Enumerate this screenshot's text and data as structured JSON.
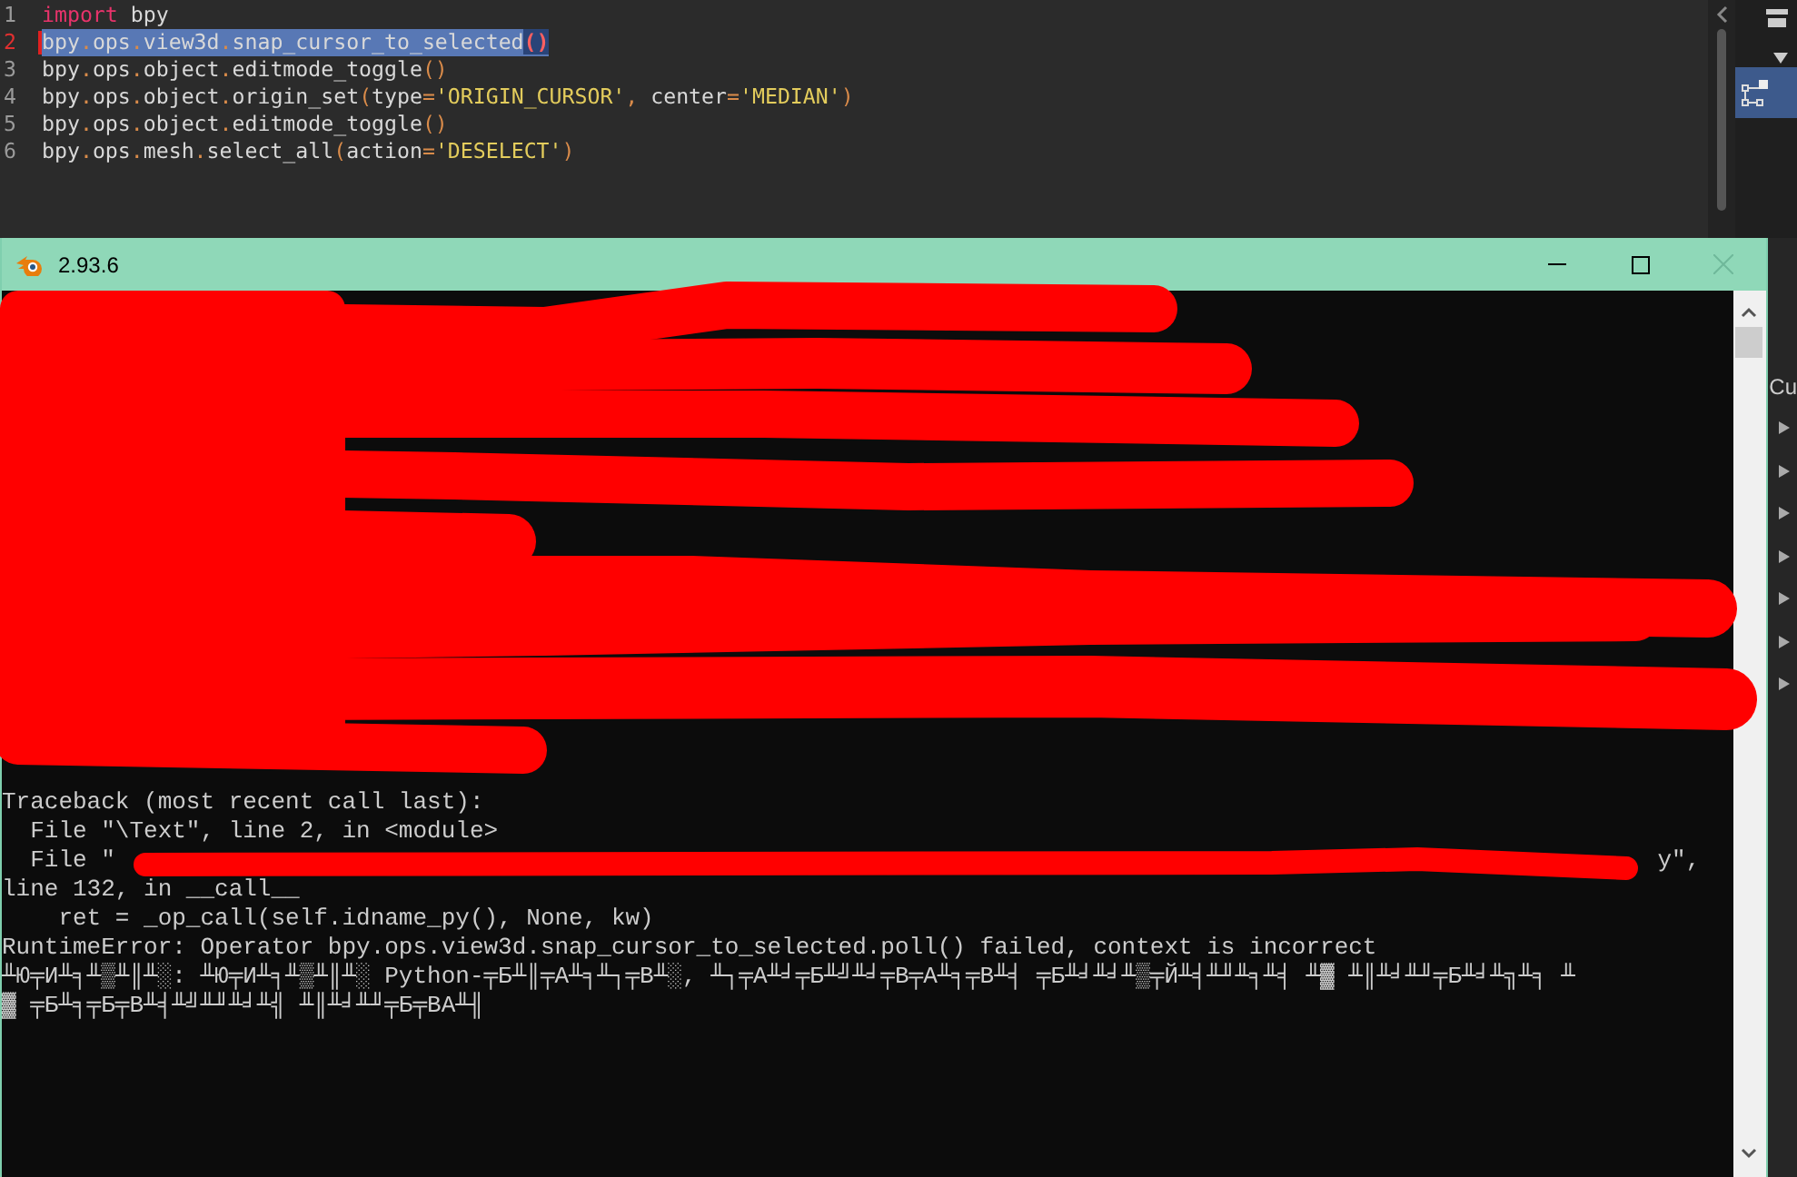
{
  "editor": {
    "lines": [
      {
        "number": "1",
        "current": false,
        "selected": false,
        "tokens": [
          {
            "kind": "keyword",
            "text": "import"
          },
          {
            "kind": "plain",
            "text": " bpy"
          }
        ]
      },
      {
        "number": "2",
        "current": true,
        "selected": true,
        "tokens": [
          {
            "kind": "plain",
            "text": "bpy"
          },
          {
            "kind": "punct",
            "text": "."
          },
          {
            "kind": "plain",
            "text": "ops"
          },
          {
            "kind": "punct",
            "text": "."
          },
          {
            "kind": "plain",
            "text": "view3d"
          },
          {
            "kind": "punct",
            "text": "."
          },
          {
            "kind": "plain",
            "text": "snap_cursor_to_selected"
          },
          {
            "kind": "match",
            "text": "()"
          }
        ]
      },
      {
        "number": "3",
        "current": false,
        "selected": false,
        "tokens": [
          {
            "kind": "plain",
            "text": "bpy"
          },
          {
            "kind": "punct",
            "text": "."
          },
          {
            "kind": "plain",
            "text": "ops"
          },
          {
            "kind": "punct",
            "text": "."
          },
          {
            "kind": "plain",
            "text": "object"
          },
          {
            "kind": "punct",
            "text": "."
          },
          {
            "kind": "plain",
            "text": "editmode_toggle"
          },
          {
            "kind": "punct",
            "text": "()"
          }
        ]
      },
      {
        "number": "4",
        "current": false,
        "selected": false,
        "tokens": [
          {
            "kind": "plain",
            "text": "bpy"
          },
          {
            "kind": "punct",
            "text": "."
          },
          {
            "kind": "plain",
            "text": "ops"
          },
          {
            "kind": "punct",
            "text": "."
          },
          {
            "kind": "plain",
            "text": "object"
          },
          {
            "kind": "punct",
            "text": "."
          },
          {
            "kind": "plain",
            "text": "origin_set"
          },
          {
            "kind": "punct",
            "text": "("
          },
          {
            "kind": "plain",
            "text": "type"
          },
          {
            "kind": "punct",
            "text": "="
          },
          {
            "kind": "string",
            "text": "'ORIGIN_CURSOR'"
          },
          {
            "kind": "punct",
            "text": ","
          },
          {
            "kind": "plain",
            "text": " center"
          },
          {
            "kind": "punct",
            "text": "="
          },
          {
            "kind": "string",
            "text": "'MEDIAN'"
          },
          {
            "kind": "punct",
            "text": ")"
          }
        ]
      },
      {
        "number": "5",
        "current": false,
        "selected": false,
        "tokens": [
          {
            "kind": "plain",
            "text": "bpy"
          },
          {
            "kind": "punct",
            "text": "."
          },
          {
            "kind": "plain",
            "text": "ops"
          },
          {
            "kind": "punct",
            "text": "."
          },
          {
            "kind": "plain",
            "text": "object"
          },
          {
            "kind": "punct",
            "text": "."
          },
          {
            "kind": "plain",
            "text": "editmode_toggle"
          },
          {
            "kind": "punct",
            "text": "()"
          }
        ]
      },
      {
        "number": "6",
        "current": false,
        "selected": false,
        "tokens": [
          {
            "kind": "plain",
            "text": "bpy"
          },
          {
            "kind": "punct",
            "text": "."
          },
          {
            "kind": "plain",
            "text": "ops"
          },
          {
            "kind": "punct",
            "text": "."
          },
          {
            "kind": "plain",
            "text": "mesh"
          },
          {
            "kind": "punct",
            "text": "."
          },
          {
            "kind": "plain",
            "text": "select_all"
          },
          {
            "kind": "punct",
            "text": "("
          },
          {
            "kind": "plain",
            "text": "action"
          },
          {
            "kind": "punct",
            "text": "="
          },
          {
            "kind": "string",
            "text": "'DESELECT'"
          },
          {
            "kind": "punct",
            "text": ")"
          }
        ]
      }
    ]
  },
  "side_panel": {
    "label": "Cu"
  },
  "console": {
    "window": {
      "title": "2.93.6"
    },
    "lines": [
      {
        "text": "Traceback (most recent call last):"
      },
      {
        "text": "  File \"\\Text\", line 2, in <module>"
      },
      {
        "text": "  File \"",
        "tail": "y\","
      },
      {
        "text": "line 132, in __call__"
      },
      {
        "text": "    ret = _op_call(self.idname_py(), None, kw)"
      },
      {
        "text": "RuntimeError: Operator bpy.ops.view3d.snap_cursor_to_selected.poll() failed, context is incorrect"
      },
      {
        "text": "╨Ю╤И╨╕╨▒╨║╨░: ╨Ю╤И╨╕╨▒╨║╨░ Python-╤Б╨║╤А╨╕╨┐╤В╨░, ╨┐╤А╨╛╤Б╨╝╨╛╤В╤А╨╕╤В╨╡ ╤Б╨╛╨╛╨▒╤Й╨╡╨╜╨╕╨╡ ╨▓ ╨║╨╛╨╜╤Б╨╛╨╗╨╕ ╨"
      },
      {
        "text": "▓ ╤Б╨╕╤Б╤В╨╡╨╝╨╜╨╛╨╣ ╨║╨╛╨╜╤Б╤ВА╨╢"
      }
    ]
  }
}
